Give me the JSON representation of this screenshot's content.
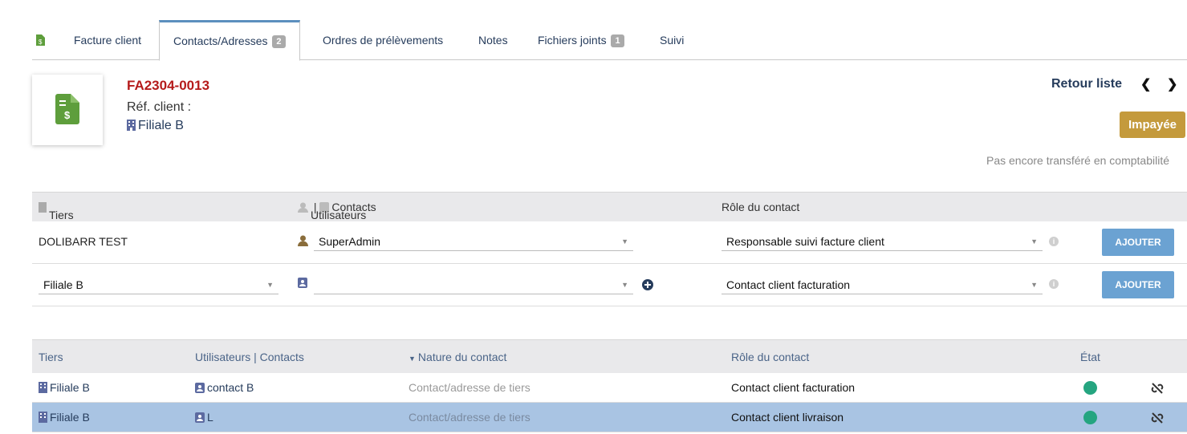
{
  "tabs": [
    {
      "label": "Facture client"
    },
    {
      "label": "Contacts/Adresses",
      "badge": "2"
    },
    {
      "label": "Ordres de prélèvements"
    },
    {
      "label": "Notes"
    },
    {
      "label": "Fichiers joints",
      "badge": "1"
    },
    {
      "label": "Suivi"
    }
  ],
  "header": {
    "ref": "FA2304-0013",
    "ref_client_label": "Réf. client :",
    "tiers": "Filiale B",
    "retour_liste": "Retour liste",
    "status": "Impayée",
    "compta_status": "Pas encore transféré en comptabilité"
  },
  "form": {
    "headers": {
      "tiers": "Tiers",
      "users": "Utilisateurs",
      "sep": "|",
      "contacts": "Contacts",
      "role": "Rôle du contact"
    },
    "rows": [
      {
        "tiers": "DOLIBARR TEST",
        "user": "SuperAdmin",
        "role": "Responsable suivi facture client",
        "button": "AJOUTER"
      },
      {
        "tiers": "Filiale B",
        "user": "",
        "role": "Contact client facturation",
        "button": "AJOUTER"
      }
    ]
  },
  "list": {
    "headers": {
      "tiers": "Tiers",
      "users": "Utilisateurs | Contacts",
      "nature": "Nature du contact",
      "role": "Rôle du contact",
      "etat": "État"
    },
    "rows": [
      {
        "tiers": "Filiale B",
        "contact": "contact B",
        "nature": "Contact/adresse de tiers",
        "role": "Contact client facturation"
      },
      {
        "tiers": "Filiale B",
        "contact": "L",
        "nature": "Contact/adresse de tiers",
        "role": "Contact client livraison"
      }
    ]
  },
  "colors": {
    "accent": "#263c5c",
    "ref": "#b51b1b",
    "status": "#c49a3c",
    "button": "#6ba2d2",
    "active": "#25a580",
    "highlight": "#a9c4e3"
  }
}
